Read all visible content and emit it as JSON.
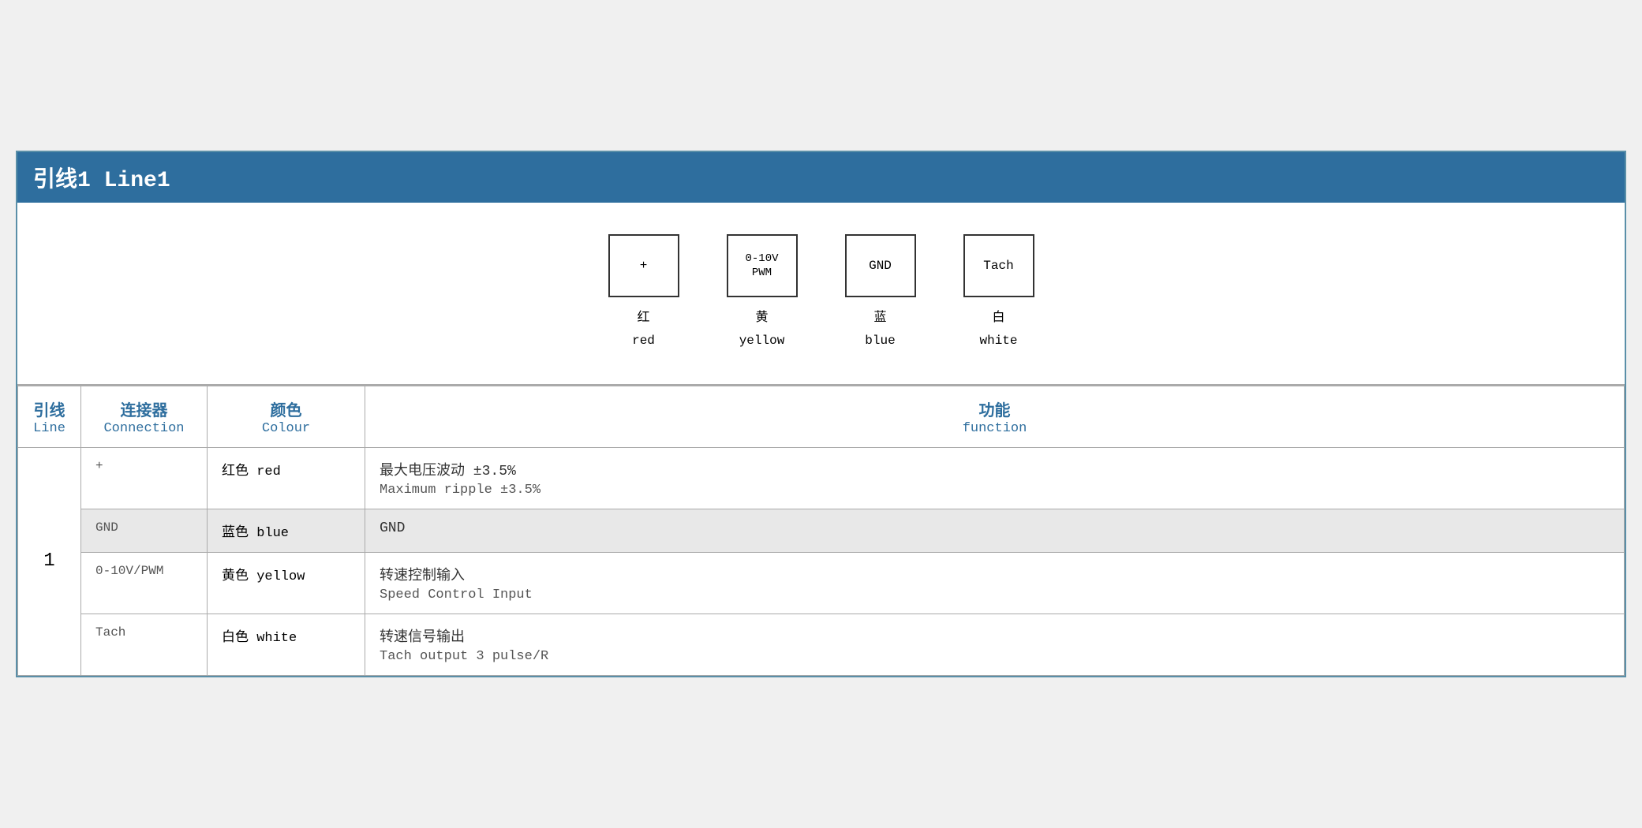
{
  "header": {
    "title": "引线1 Line1"
  },
  "diagram": {
    "pins": [
      {
        "id": "plus",
        "symbol": "+",
        "zh": "红",
        "en": "red"
      },
      {
        "id": "pwm",
        "symbol": "0-10V\nPWM",
        "zh": "黄",
        "en": "yellow"
      },
      {
        "id": "gnd",
        "symbol": "GND",
        "zh": "蓝",
        "en": "blue"
      },
      {
        "id": "tach",
        "symbol": "Tach",
        "zh": "白",
        "en": "white"
      }
    ]
  },
  "table": {
    "headers": {
      "line_zh": "引线",
      "line_en": "Line",
      "conn_zh": "连接器",
      "conn_en": "Connection",
      "color_zh": "颜色",
      "color_en": "Colour",
      "func_zh": "功能",
      "func_en": "function"
    },
    "rows": [
      {
        "line": "1",
        "connector": "+",
        "color_zh": "红色 red",
        "func_zh": "最大电压波动 ±3.5%",
        "func_en": "Maximum ripple ±3.5%",
        "bg": "white"
      },
      {
        "line": "",
        "connector": "GND",
        "color_zh": "蓝色 blue",
        "func_zh": "GND",
        "func_en": "",
        "bg": "gray"
      },
      {
        "line": "",
        "connector": "0-10V/PWM",
        "color_zh": "黄色 yellow",
        "func_zh": "转速控制输入",
        "func_en": "Speed Control Input",
        "bg": "white"
      },
      {
        "line": "",
        "connector": "Tach",
        "color_zh": "白色 white",
        "func_zh": "转速信号输出",
        "func_en": "Tach output 3 pulse/R",
        "bg": "white"
      }
    ]
  },
  "colors": {
    "header_bg": "#2e6e9e",
    "header_text": "#ffffff",
    "accent": "#2e6e9e",
    "row_gray": "#e8e8e8",
    "border": "#aaaaaa"
  }
}
